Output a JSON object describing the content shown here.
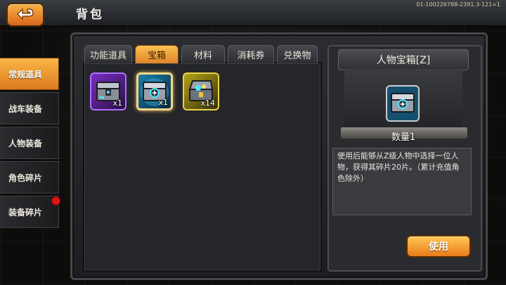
{
  "header": {
    "title": "背包",
    "id_text": "01-100226788-2391.3-121=1",
    "back_icon": "back-arrow-icon"
  },
  "sidebar": {
    "items": [
      {
        "label": "常规道具",
        "active": true
      },
      {
        "label": "战车装备",
        "active": false
      },
      {
        "label": "人物装备",
        "active": false
      },
      {
        "label": "角色碎片",
        "active": false
      },
      {
        "label": "装备碎片",
        "active": false,
        "badge": true
      }
    ]
  },
  "tabs": [
    {
      "label": "功能道具",
      "active": false
    },
    {
      "label": "宝箱",
      "active": true
    },
    {
      "label": "材料",
      "active": false
    },
    {
      "label": "消耗券",
      "active": false
    },
    {
      "label": "兑换物",
      "active": false
    }
  ],
  "items": [
    {
      "icon": "purple-chest-icon",
      "count": "x1"
    },
    {
      "icon": "blue-chest-icon",
      "count": "x1",
      "selected": true
    },
    {
      "icon": "gold-chest-icon",
      "count": "x14"
    }
  ],
  "detail": {
    "title": "人物宝箱[Z]",
    "quantity": "数量1",
    "description": "使用后能够从Z级人物中选择一位人物，获得其碎片20片。（累计充值角色除外）",
    "use_label": "使用"
  },
  "colors": {
    "accent": "#f0a03a",
    "badge": "#e0141a"
  }
}
